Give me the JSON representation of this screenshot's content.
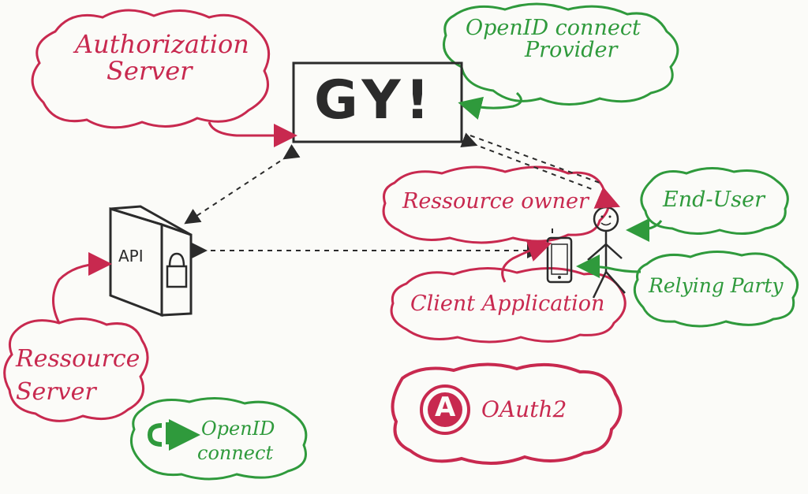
{
  "colors": {
    "red": "#c8294f",
    "green": "#2f9a3c",
    "ink": "#2b2b2b"
  },
  "labels": {
    "authorization_server": [
      "Authorization",
      "Server"
    ],
    "openid_provider": [
      "OpenID connect",
      "Provider"
    ],
    "server_logo": "GY!",
    "resource_owner": "Ressource owner",
    "end_user": "End-User",
    "relying_party": "Relying Party",
    "client_application": "Client Application",
    "api": "API",
    "resource_server": [
      "Ressource",
      "Server"
    ],
    "openid_connect_logo_text": [
      "OpenID",
      "connect"
    ],
    "openid_connect_mark": "c→",
    "oauth2_logo_letter": "A",
    "oauth2_text": "OAuth2"
  },
  "icons": {
    "server": "server-box-icon",
    "api": "api-box-icon",
    "lock": "padlock-icon",
    "phone": "smartphone-icon",
    "user": "stick-figure-icon"
  }
}
